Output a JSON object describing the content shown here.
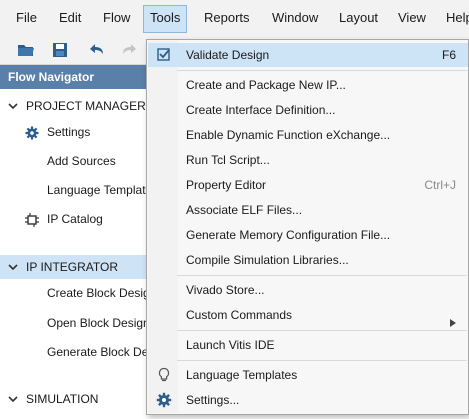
{
  "menubar": {
    "items": [
      {
        "label": "File"
      },
      {
        "label": "Edit"
      },
      {
        "label": "Flow"
      },
      {
        "label": "Tools"
      },
      {
        "label": "Reports"
      },
      {
        "label": "Window"
      },
      {
        "label": "Layout"
      },
      {
        "label": "View"
      },
      {
        "label": "Help"
      }
    ]
  },
  "toolbar": {
    "icons": [
      "open-folder-icon",
      "save-icon",
      "undo-icon",
      "redo-icon"
    ]
  },
  "flow_navigator": {
    "title": "Flow Navigator",
    "sections": [
      {
        "label": "PROJECT MANAGER",
        "items": [
          {
            "label": "Settings",
            "icon": "gear-icon"
          },
          {
            "label": "Add Sources"
          },
          {
            "label": "Language Templates"
          },
          {
            "label": "IP Catalog",
            "icon": "ip-catalog-icon"
          }
        ]
      },
      {
        "label": "IP INTEGRATOR",
        "items": [
          {
            "label": "Create Block Design"
          },
          {
            "label": "Open Block Design"
          },
          {
            "label": "Generate Block Design"
          }
        ]
      },
      {
        "label": "SIMULATION",
        "items": []
      }
    ]
  },
  "tools_menu": {
    "items": [
      {
        "label": "Validate Design",
        "shortcut": "F6",
        "icon": "checkbox-icon"
      },
      {
        "label": "Create and Package New IP..."
      },
      {
        "label": "Create Interface Definition..."
      },
      {
        "label": "Enable Dynamic Function eXchange..."
      },
      {
        "label": "Run Tcl Script..."
      },
      {
        "label": "Property Editor",
        "shortcut": "Ctrl+J"
      },
      {
        "label": "Associate ELF Files..."
      },
      {
        "label": "Generate Memory Configuration File..."
      },
      {
        "label": "Compile Simulation Libraries..."
      },
      {
        "label": "Vivado Store..."
      },
      {
        "label": "Custom Commands"
      },
      {
        "label": "Launch Vitis IDE"
      },
      {
        "label": "Language Templates",
        "icon": "lightbulb-icon"
      },
      {
        "label": "Settings...",
        "icon": "gear-icon"
      }
    ]
  },
  "colors": {
    "accent": "#cde3f6",
    "nav_header": "#5a7fa8",
    "menu_background": "#f7f7f7"
  }
}
